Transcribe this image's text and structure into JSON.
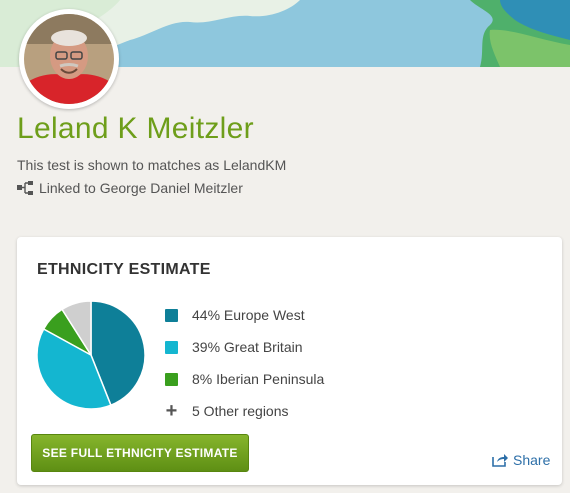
{
  "profile": {
    "name": "Leland K Meitzler",
    "test_shown_as": "This test is shown to matches as LelandKM",
    "linked_to": "Linked to George Daniel Meitzler"
  },
  "ethnicity": {
    "title": "ETHNICITY ESTIMATE",
    "regions": [
      {
        "label": "44% Europe West",
        "percent": 44,
        "color": "#0e7f98"
      },
      {
        "label": "39% Great Britain",
        "percent": 39,
        "color": "#14b6d0"
      },
      {
        "label": "8% Iberian Peninsula",
        "percent": 8,
        "color": "#3a9f1e"
      }
    ],
    "other": {
      "label": "5 Other regions",
      "percent": 9,
      "color": "#cfcfcf"
    },
    "button_label": "SEE FULL ETHNICITY ESTIMATE",
    "share_label": "Share"
  }
}
